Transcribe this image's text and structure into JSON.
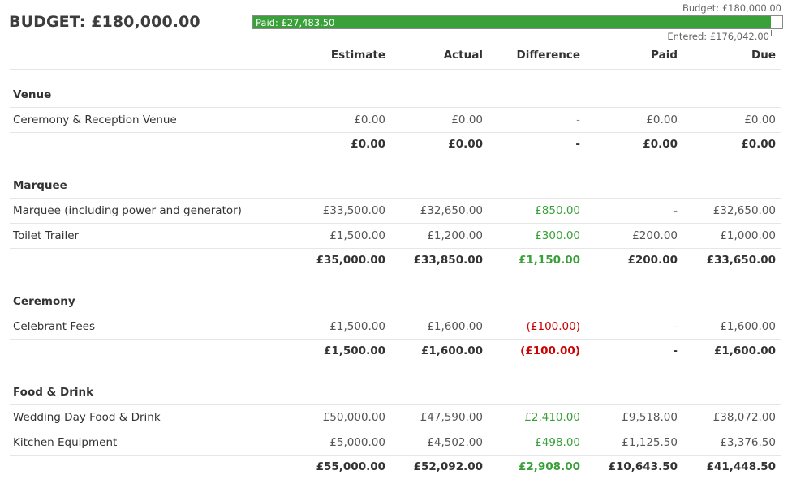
{
  "budget": {
    "title": "BUDGET:",
    "amount": "£180,000.00",
    "bar_budget_label": "Budget: £180,000.00",
    "bar_entered_label": "Entered: £176,042.00",
    "bar_paid_label": "Paid: £27,483.50",
    "entered_fraction": 0.978,
    "colors": {
      "bar": "#3aa13a",
      "positive": "#3aa13a",
      "negative": "#cc0000"
    }
  },
  "columns": [
    "Estimate",
    "Actual",
    "Difference",
    "Paid",
    "Due"
  ],
  "sections": [
    {
      "name": "Venue",
      "items": [
        {
          "name": "Ceremony & Reception Venue",
          "estimate": "£0.00",
          "actual": "£0.00",
          "difference": "-",
          "paid": "£0.00",
          "due": "£0.00"
        }
      ],
      "total": {
        "estimate": "£0.00",
        "actual": "£0.00",
        "difference": "-",
        "paid": "£0.00",
        "due": "£0.00"
      }
    },
    {
      "name": "Marquee",
      "items": [
        {
          "name": "Marquee (including power and generator)",
          "estimate": "£33,500.00",
          "actual": "£32,650.00",
          "difference": "£850.00",
          "paid": "-",
          "due": "£32,650.00"
        },
        {
          "name": "Toilet Trailer",
          "estimate": "£1,500.00",
          "actual": "£1,200.00",
          "difference": "£300.00",
          "paid": "£200.00",
          "due": "£1,000.00"
        }
      ],
      "total": {
        "estimate": "£35,000.00",
        "actual": "£33,850.00",
        "difference": "£1,150.00",
        "paid": "£200.00",
        "due": "£33,650.00"
      }
    },
    {
      "name": "Ceremony",
      "items": [
        {
          "name": "Celebrant Fees",
          "estimate": "£1,500.00",
          "actual": "£1,600.00",
          "difference": "(£100.00)",
          "paid": "-",
          "due": "£1,600.00"
        }
      ],
      "total": {
        "estimate": "£1,500.00",
        "actual": "£1,600.00",
        "difference": "(£100.00)",
        "paid": "-",
        "due": "£1,600.00"
      }
    },
    {
      "name": "Food & Drink",
      "items": [
        {
          "name": "Wedding Day Food & Drink",
          "estimate": "£50,000.00",
          "actual": "£47,590.00",
          "difference": "£2,410.00",
          "paid": "£9,518.00",
          "due": "£38,072.00"
        },
        {
          "name": "Kitchen Equipment",
          "estimate": "£5,000.00",
          "actual": "£4,502.00",
          "difference": "£498.00",
          "paid": "£1,125.50",
          "due": "£3,376.50"
        }
      ],
      "total": {
        "estimate": "£55,000.00",
        "actual": "£52,092.00",
        "difference": "£2,908.00",
        "paid": "£10,643.50",
        "due": "£41,448.50"
      }
    }
  ]
}
